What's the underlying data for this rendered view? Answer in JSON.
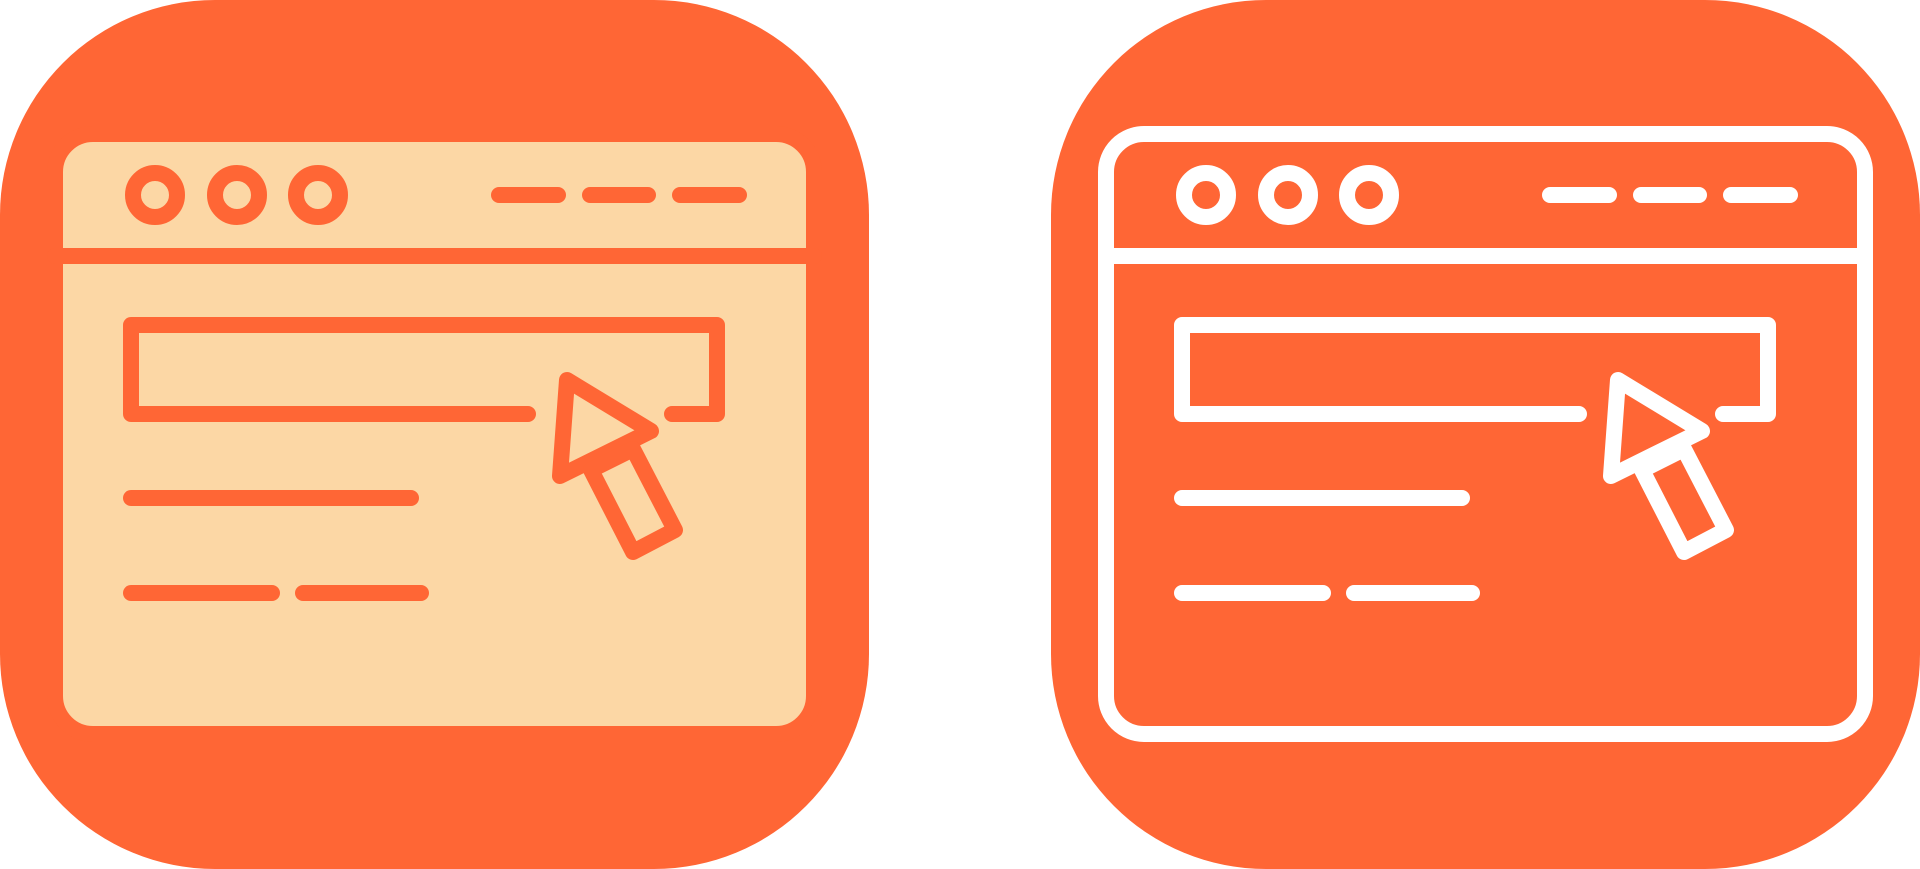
{
  "icons": [
    {
      "name": "browser-window-click-icon",
      "style": "filled",
      "background_color": "#FF6635",
      "window_fill": "#FCD7A5",
      "stroke_color": "#FF6635"
    },
    {
      "name": "browser-window-click-icon",
      "style": "outline",
      "background_color": "#FF6635",
      "window_fill": "#FF6635",
      "stroke_color": "#FFFFFF"
    }
  ]
}
